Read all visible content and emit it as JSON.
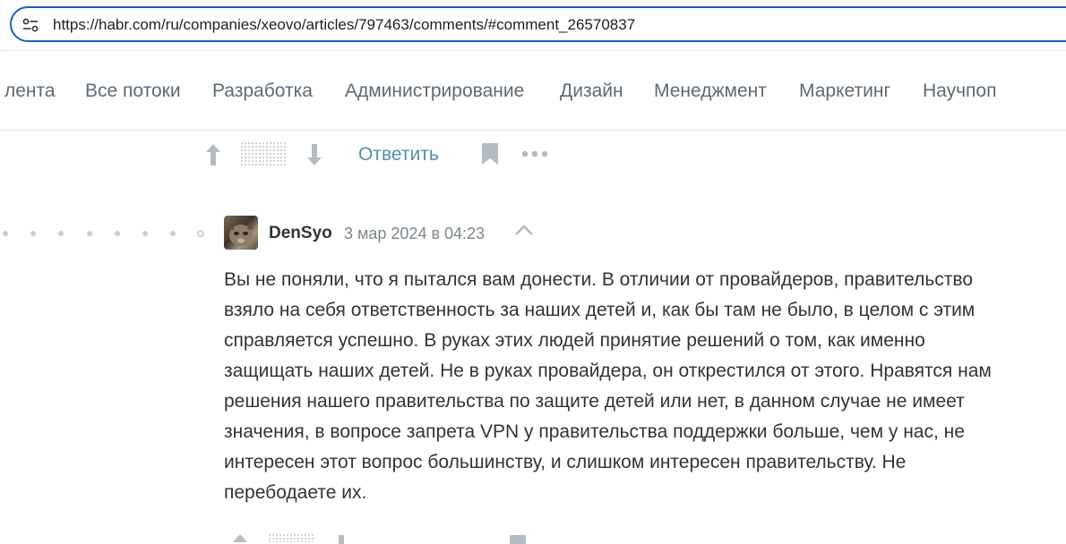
{
  "browser": {
    "url": "https://habr.com/ru/companies/xeovo/articles/797463/comments/#comment_26570837",
    "site_settings_icon": "tune-icon"
  },
  "nav": {
    "items": [
      "лента",
      "Все потоки",
      "Разработка",
      "Администрирование",
      "Дизайн",
      "Менеджмент",
      "Маркетинг",
      "Научпоп"
    ]
  },
  "actions": {
    "reply_label": "Ответить",
    "icons": [
      "arrow-up-icon",
      "rating-placeholder",
      "arrow-down-icon",
      "bookmark-icon",
      "more-icon"
    ]
  },
  "comment": {
    "author": "DenSyo",
    "date": "3 мар 2024 в 04:23",
    "text": "Вы не поняли, что я пытался вам донести. В отличии от провайдеров, правительство взяло на себя ответственность за наших детей и, как бы там не было, в целом с этим справляется успешно. В руках этих людей принятие решений о том, как именно защищать наших детей. Не в руках провайдера, он открестился от этого. Нравятся нам решения нашего правительства по защите детей или нет, в данном случае не имеет значения, в вопросе запрета VPN у правительства поддержки больше, чем у нас, не интересен этот вопрос большинству, и слишком интересен правительству. Не перебодаете их."
  },
  "colors": {
    "accent": "#548eaa",
    "address_border": "#1f5fb8",
    "nav_text": "#5f6a72",
    "icon_gray": "#b3bcc2"
  }
}
